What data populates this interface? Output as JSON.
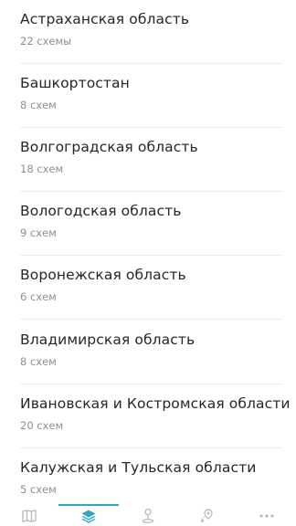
{
  "regions": [
    {
      "name": "Астраханская область",
      "count": "22 схемы"
    },
    {
      "name": "Башкортостан",
      "count": "8 схем"
    },
    {
      "name": "Волгоградская область",
      "count": "18 схем"
    },
    {
      "name": "Вологодская область",
      "count": "9 схем"
    },
    {
      "name": "Воронежская область",
      "count": "6 схем"
    },
    {
      "name": "Владимирская область",
      "count": "8 схем"
    },
    {
      "name": "Ивановская и Костромская области",
      "count": "20 схем"
    },
    {
      "name": "Калужская и Тульская области",
      "count": "5 схем"
    }
  ],
  "nav": {
    "active_tab": "layers",
    "accent_color": "#2aa8c9",
    "inactive_color": "#b5b5b5",
    "tabs": [
      {
        "id": "map",
        "icon": "map-icon"
      },
      {
        "id": "layers",
        "icon": "layers-icon"
      },
      {
        "id": "location",
        "icon": "person-pin-icon"
      },
      {
        "id": "route",
        "icon": "route-pin-icon"
      },
      {
        "id": "more",
        "icon": "more-dots-icon"
      }
    ]
  }
}
